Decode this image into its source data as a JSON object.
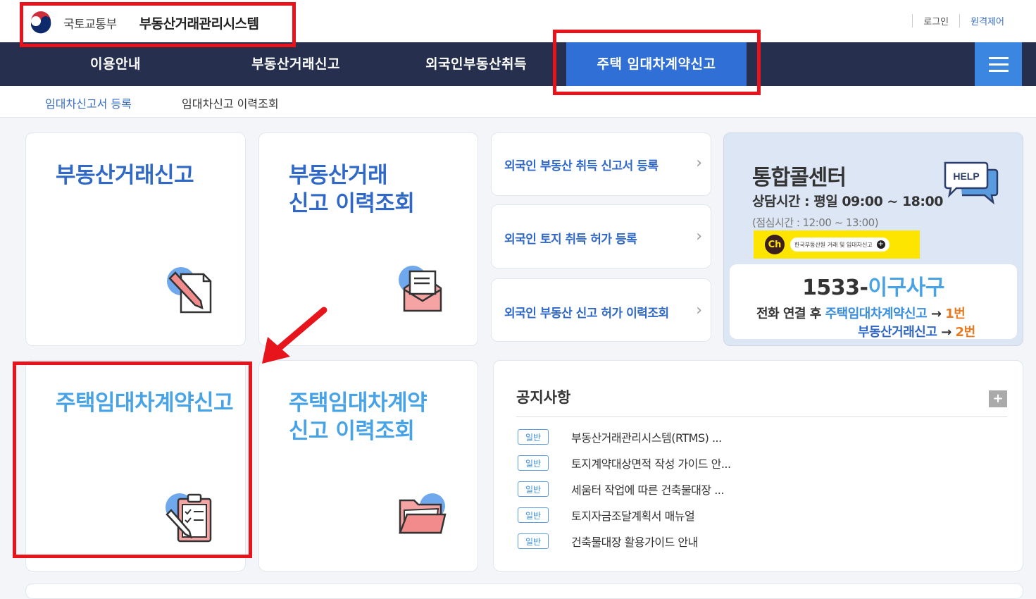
{
  "header": {
    "ministry": "국토교통부",
    "system_name": "부동산거래관리시스템",
    "links": [
      "로그인",
      "원격제어"
    ]
  },
  "nav": {
    "items": [
      {
        "label": "이용안내"
      },
      {
        "label": "부동산거래신고"
      },
      {
        "label": "외국인부동산취득"
      },
      {
        "label": "주택 임대차계약신고",
        "active": true
      }
    ],
    "menu_icon": "hamburger-icon"
  },
  "subnav": [
    "임대차신고서 등록",
    "임대차신고 이력조회"
  ],
  "cards": {
    "realestate_report": {
      "title": [
        "부동산거래신고"
      ],
      "icon": "document-pen-icon"
    },
    "realestate_history": {
      "title": [
        "부동산거래",
        "신고 이력조회"
      ],
      "icon": "envelope-letter-icon"
    },
    "lease_report": {
      "title": [
        "주택임대차계약신고"
      ],
      "icon": "clipboard-check-icon"
    },
    "lease_history": {
      "title": [
        "주택임대차계약",
        "신고 이력조회"
      ],
      "icon": "folder-icon"
    }
  },
  "foreign_links": [
    {
      "label": "외국인 부동산 취득 신고서 등록"
    },
    {
      "label": "외국인 토지 취득 허가 등록"
    },
    {
      "label": "외국인 부동산 신고 허가 이력조회"
    }
  ],
  "call_center": {
    "title": "통합콜센터",
    "hours": "상담시간 : 평일 09:00 ~ 18:00",
    "break": "(점심시간 : 12:00 ~ 13:00)",
    "help_badge": "HELP",
    "kakao": {
      "ch": "Ch",
      "label": "한국부동산원 거래 및 임대차신고"
    },
    "phone_prefix": "1533-",
    "phone_word": "이구사구",
    "guide": {
      "prefix": "전화 연결 후 ",
      "lease": "주택임대차계약신고",
      "arrow": " → ",
      "lease_num": "1번",
      "realestate": "부동산거래신고",
      "realestate_num": "2번"
    }
  },
  "notice": {
    "title": "공지사항",
    "more": "+",
    "items": [
      {
        "badge": "일반",
        "text": "부동산거래관리시스템(RTMS) ..."
      },
      {
        "badge": "일반",
        "text": "토지계약대상면적 작성 가이드 안..."
      },
      {
        "badge": "일반",
        "text": "세움터 작업에 따른 건축물대장 ..."
      },
      {
        "badge": "일반",
        "text": "토지자금조달계획서 매뉴얼"
      },
      {
        "badge": "일반",
        "text": "건축물대장 활용가이드 안내"
      }
    ]
  },
  "colors": {
    "nav_bg": "#272f4f",
    "nav_active": "#2f6fd6",
    "title_blue": "#2f68c7",
    "light_blue": "#47a3e6",
    "highlight_red": "#e8141b",
    "orange": "#e87a22"
  }
}
